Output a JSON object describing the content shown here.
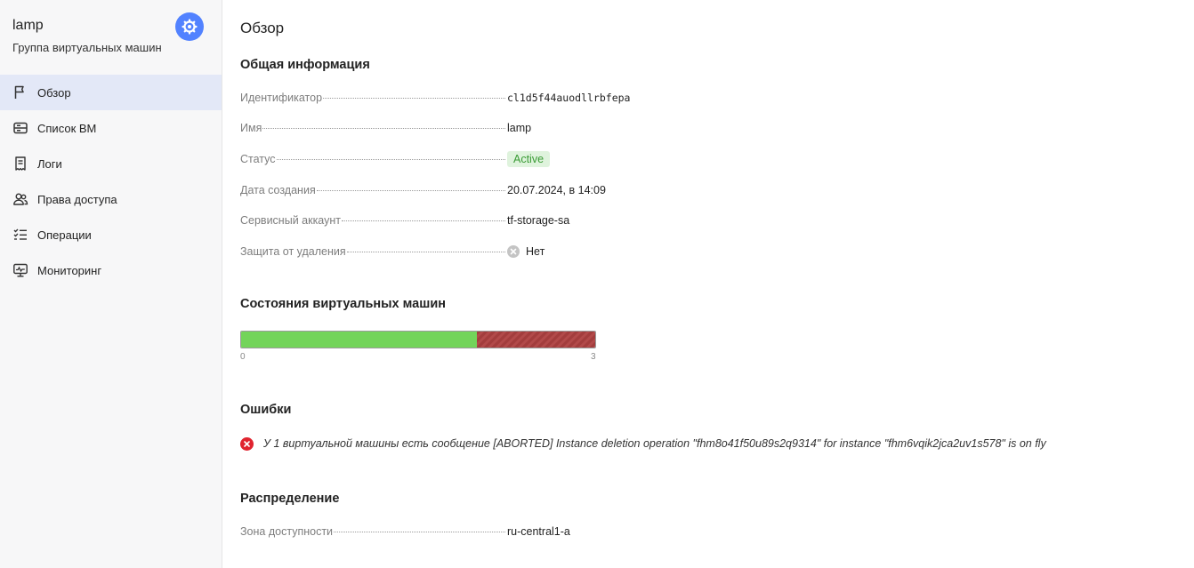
{
  "sidebar": {
    "title": "lamp",
    "subtitle": "Группа виртуальных машин",
    "service_icon": "instance-group-icon",
    "accent": "#5282ff",
    "items": [
      {
        "label": "Обзор",
        "icon": "flag-icon",
        "active": true
      },
      {
        "label": "Список ВМ",
        "icon": "server-list-icon",
        "active": false
      },
      {
        "label": "Логи",
        "icon": "receipt-icon",
        "active": false
      },
      {
        "label": "Права доступа",
        "icon": "persons-icon",
        "active": false
      },
      {
        "label": "Операции",
        "icon": "list-check-icon",
        "active": false
      },
      {
        "label": "Мониторинг",
        "icon": "monitor-icon",
        "active": false
      }
    ]
  },
  "main": {
    "page_title": "Обзор",
    "general": {
      "title": "Общая информация",
      "id_label": "Идентификатор",
      "id_value": "cl1d5f44auodllrbfepa",
      "name_label": "Имя",
      "name_value": "lamp",
      "status_label": "Статус",
      "status_value": "Active",
      "created_label": "Дата создания",
      "created_value": "20.07.2024, в 14:09",
      "sa_label": "Сервисный аккаунт",
      "sa_value": "tf-storage-sa",
      "protect_label": "Защита от удаления",
      "protect_value": "Нет"
    },
    "vm_states": {
      "title": "Состояния виртуальных машин",
      "total": 3,
      "ok_count": 2,
      "error_count": 1,
      "tick_min": "0",
      "tick_max": "3",
      "ok_color": "#73d45a",
      "error_color": "#a33d3d"
    },
    "errors": {
      "title": "Ошибки",
      "message": "У 1 виртуальной машины есть сообщение [ABORTED] Instance deletion operation \"fhm8o41f50u89s2q9314\" for instance \"fhm6vqik2jca2uv1s578\" is on fly"
    },
    "distribution": {
      "title": "Распределение",
      "zone_label": "Зона доступности",
      "zone_value": "ru-central1-a"
    }
  }
}
